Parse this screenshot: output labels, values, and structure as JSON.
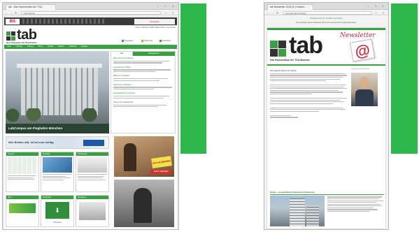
{
  "colors": {
    "green": "#2eb84c",
    "tab_green": "#3f9f3a",
    "logo_dark": "#222222",
    "newsletter_red": "#c8283a",
    "site_green_bar": "#4a9a2e"
  },
  "left_window": {
    "tab_title": "tab - Das Fachmedium der TGA",
    "url": "www.tab.de",
    "top_banner_logo": "BS",
    "banner_right_text": "Neuheiten",
    "util_links": "Home | Sitemap | AGB | Datenschutz | Impressum",
    "logo": "tab",
    "tagline": "Das Fachmedium der TGA-Branche",
    "top_actions": [
      "Newsletter",
      "RSS-Feed",
      "Newsletter"
    ],
    "nav_items": [
      "Start",
      "Heizung",
      "Lüftung",
      "Klima",
      "Sanitär",
      "Elektro",
      "Gebäude",
      "Energie"
    ],
    "widget_tabs": [
      "Neu",
      "Meistgelesen"
    ],
    "news_items": [
      "Mehr Raum fürs Wohnen",
      "Innovationen im Blick",
      "Effizienz im Neubau",
      "Sanierung im Bestand",
      "Energieeffiziente Lösungen",
      "Zukunft der Haustechnik"
    ],
    "hero_caption": "LabCampus am Flughafen München",
    "banner_text": "Wer Bestes will, ist bei uns richtig",
    "sections": [
      "Termine",
      "Produkte",
      "Fachwissen"
    ],
    "side_ad": "MACHS BESSER",
    "side_ad_button": "JETZT ANSEHEN",
    "bottom_sections": [
      "Jobs",
      "Download",
      "Newsletter"
    ],
    "download_label": "Download"
  },
  "right_window": {
    "tab_title": "tab Newsletter 2016/10 | Kostenl...",
    "url": "www.tab.de/newsletter",
    "header_links": "Newsletter-Archiv | Kontakt | Impressum",
    "notice": "Sie empfangen diesen Newsletter, da Sie sich auf www.tab.de angemeldet haben.",
    "logo": "tab",
    "tagline": "Das Fachmedium der TGA-Branche",
    "newsletter_word": "Newsletter",
    "greeting": "Sehr geehrte Damen und Herren,",
    "article_title": "Schule – energieeffizient für Neubau und Sanierung",
    "sidebar_link": "Folgen Sie uns auf Twitter"
  }
}
